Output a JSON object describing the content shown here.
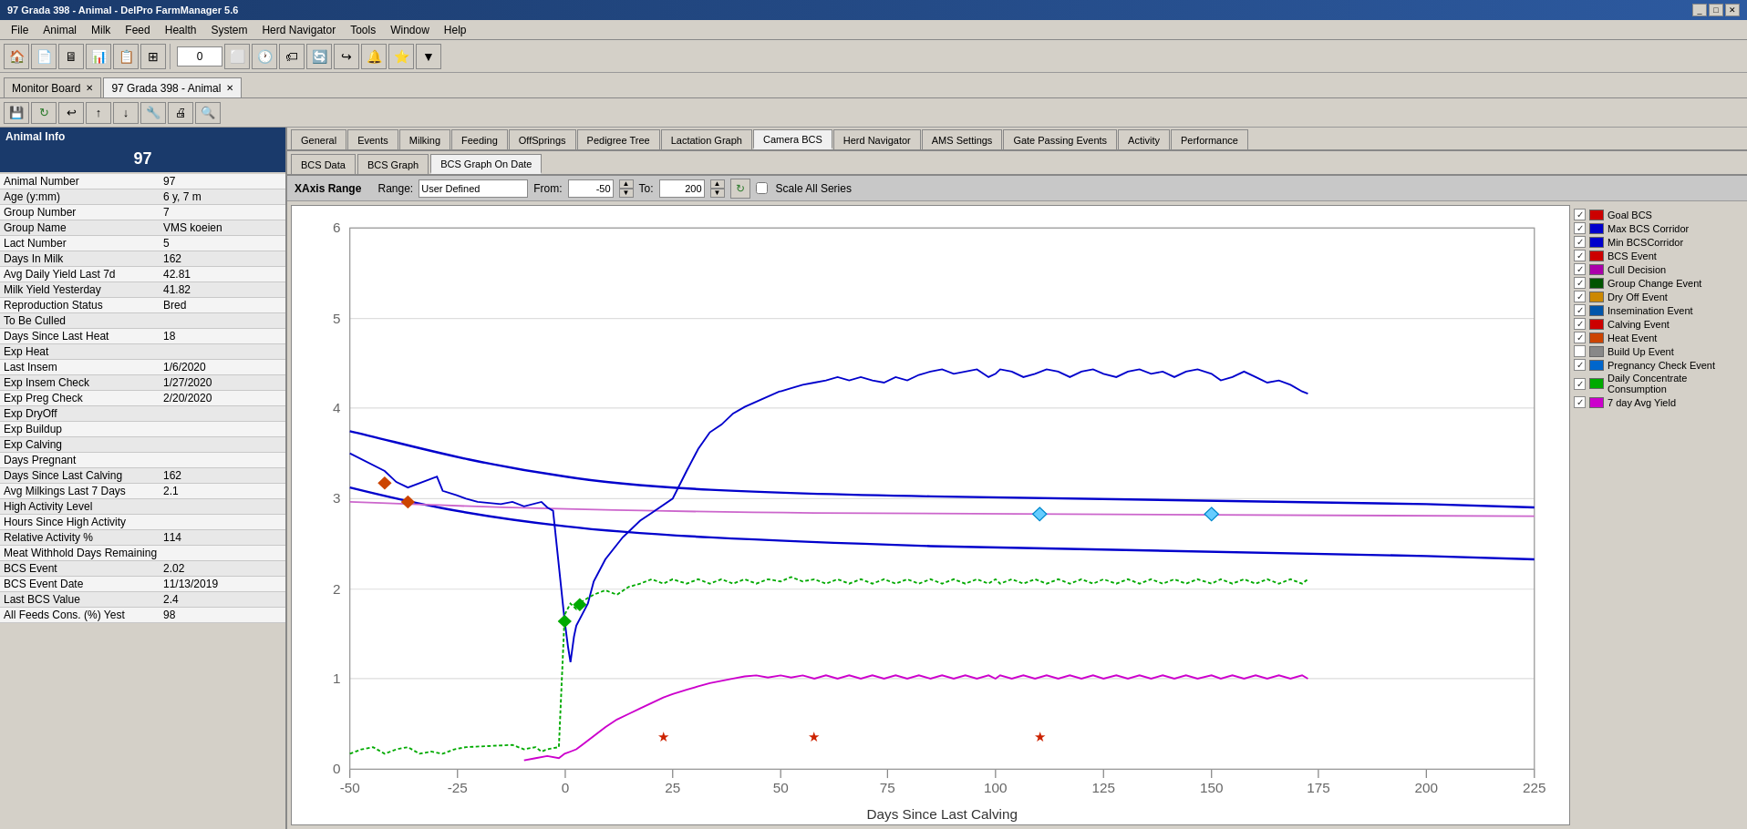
{
  "titleBar": {
    "title": "97 Grada 398 - Animal - DelPro FarmManager 5.6",
    "winControls": [
      "_",
      "□",
      "✕"
    ]
  },
  "menuBar": {
    "items": [
      "File",
      "Animal",
      "Milk",
      "Feed",
      "Health",
      "System",
      "Herd Navigator",
      "Tools",
      "Window",
      "Help"
    ]
  },
  "toolbar": {
    "counter": "0"
  },
  "tabs": [
    {
      "label": "Monitor Board",
      "active": false,
      "closable": true
    },
    {
      "label": "97 Grada 398 - Animal",
      "active": true,
      "closable": true
    }
  ],
  "animalInfo": {
    "header": "Animal Info",
    "animalNumber": "97",
    "fields": [
      {
        "label": "Animal Number",
        "value": "97"
      },
      {
        "label": "Age (y:mm)",
        "value": "6 y, 7 m"
      },
      {
        "label": "Group Number",
        "value": "7"
      },
      {
        "label": "Group Name",
        "value": "VMS koeien"
      },
      {
        "label": "Lact Number",
        "value": "5"
      },
      {
        "label": "Days In Milk",
        "value": "162"
      },
      {
        "label": "Avg Daily Yield Last 7d",
        "value": "42.81"
      },
      {
        "label": "Milk Yield Yesterday",
        "value": "41.82"
      },
      {
        "label": "Reproduction Status",
        "value": "Bred"
      },
      {
        "label": "To Be Culled",
        "value": ""
      },
      {
        "label": "Days Since Last Heat",
        "value": "18"
      },
      {
        "label": "Exp Heat",
        "value": ""
      },
      {
        "label": "Last Insem",
        "value": "1/6/2020"
      },
      {
        "label": "Exp Insem Check",
        "value": "1/27/2020"
      },
      {
        "label": "Exp Preg Check",
        "value": "2/20/2020"
      },
      {
        "label": "Exp DryOff",
        "value": ""
      },
      {
        "label": "Exp Buildup",
        "value": ""
      },
      {
        "label": "Exp Calving",
        "value": ""
      },
      {
        "label": "Days Pregnant",
        "value": ""
      },
      {
        "label": "Days Since Last Calving",
        "value": "162"
      },
      {
        "label": "Avg Milkings Last 7 Days",
        "value": "2.1"
      },
      {
        "label": "High Activity Level",
        "value": ""
      },
      {
        "label": "Hours Since High Activity",
        "value": ""
      },
      {
        "label": "Relative Activity %",
        "value": "114"
      },
      {
        "label": "Meat Withhold Days Remaining",
        "value": ""
      },
      {
        "label": "BCS Event",
        "value": "2.02"
      },
      {
        "label": "BCS Event Date",
        "value": "11/13/2019"
      },
      {
        "label": "Last BCS Value",
        "value": "2.4"
      },
      {
        "label": "All Feeds Cons. (%) Yest",
        "value": "98"
      }
    ]
  },
  "navTabs": [
    {
      "label": "General",
      "active": false
    },
    {
      "label": "Events",
      "active": false
    },
    {
      "label": "Milking",
      "active": false
    },
    {
      "label": "Feeding",
      "active": false
    },
    {
      "label": "OffSprings",
      "active": false
    },
    {
      "label": "Pedigree Tree",
      "active": false
    },
    {
      "label": "Lactation Graph",
      "active": false
    },
    {
      "label": "Camera BCS",
      "active": true
    },
    {
      "label": "Herd Navigator",
      "active": false
    },
    {
      "label": "AMS Settings",
      "active": false
    },
    {
      "label": "Gate Passing Events",
      "active": false
    },
    {
      "label": "Activity",
      "active": false
    },
    {
      "label": "Performance",
      "active": false
    }
  ],
  "subTabs": [
    {
      "label": "BCS Data",
      "active": false
    },
    {
      "label": "BCS Graph",
      "active": false
    },
    {
      "label": "BCS Graph On Date",
      "active": true
    }
  ],
  "xaxisBar": {
    "label": "XAxis Range",
    "rangeLabel": "Range:",
    "rangeValue": "User Defined",
    "fromLabel": "From:",
    "fromValue": "-50",
    "toLabel": "To:",
    "toValue": "200",
    "scaleLabel": "Scale All Series"
  },
  "legend": {
    "items": [
      {
        "label": "Goal BCS",
        "checked": true,
        "color": "#cc0000"
      },
      {
        "label": "Max BCS Corridor",
        "checked": true,
        "color": "#0000cc"
      },
      {
        "label": "Min BCSCorridor",
        "checked": true,
        "color": "#0000cc"
      },
      {
        "label": "BCS Event",
        "checked": true,
        "color": "#cc0000"
      },
      {
        "label": "Cull Decision",
        "checked": true,
        "color": "#aa00aa"
      },
      {
        "label": "Group Change Event",
        "checked": true,
        "color": "#005500"
      },
      {
        "label": "Dry Off Event",
        "checked": true,
        "color": "#cc8800"
      },
      {
        "label": "Insemination Event",
        "checked": true,
        "color": "#0055aa"
      },
      {
        "label": "Calving Event",
        "checked": true,
        "color": "#cc0000"
      },
      {
        "label": "Heat Event",
        "checked": true,
        "color": "#cc4400"
      },
      {
        "label": "Build Up Event",
        "checked": false,
        "color": "#888888"
      },
      {
        "label": "Pregnancy Check Event",
        "checked": true,
        "color": "#0066cc"
      },
      {
        "label": "Daily Concentrate Consumption",
        "checked": true,
        "color": "#00aa00"
      },
      {
        "label": "7 day Avg Yield",
        "checked": true,
        "color": "#cc00cc"
      }
    ]
  },
  "chart": {
    "xLabel": "Days Since Last Calving",
    "yTicks": [
      "0",
      "1",
      "2",
      "3",
      "4",
      "5",
      "6"
    ],
    "xTicks": [
      "-50",
      "-25",
      "0",
      "25",
      "50",
      "75",
      "100",
      "125",
      "150",
      "175",
      "200",
      "225"
    ]
  }
}
